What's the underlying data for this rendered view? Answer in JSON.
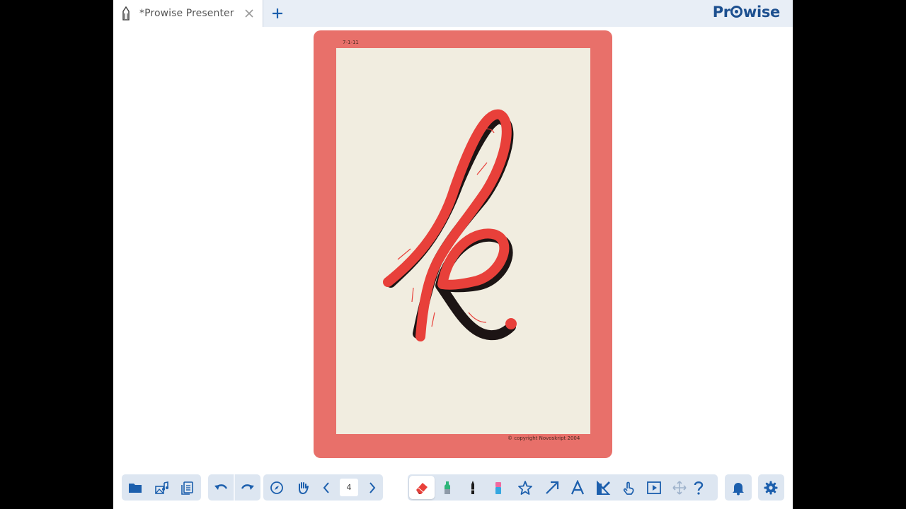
{
  "window": {
    "tab_title": "*Prowise Presenter",
    "brand": {
      "before": "Pr",
      "after": "wise"
    }
  },
  "card": {
    "code": "7-1-11",
    "copyright": "© copyright Novoskript 2004",
    "letter": "k"
  },
  "toolbar": {
    "page_number": "4",
    "file_tools": [
      "folder-icon",
      "media-library-icon",
      "pages-icon"
    ],
    "history_tools": [
      "undo-icon",
      "redo-icon"
    ],
    "navigation_tools": [
      "compass-icon",
      "hand-icon",
      "chevron-left-icon",
      "chevron-right-icon"
    ],
    "drawing_tools": [
      "eraser-icon",
      "highlighter-icon",
      "pen-icon",
      "marker-icon",
      "star-icon",
      "arrow-icon",
      "text-icon",
      "ruler-icon",
      "touch-icon",
      "screen-icon",
      "move-icon",
      "help-icon"
    ],
    "system_tools": [
      "bell-icon",
      "gear-icon"
    ]
  },
  "colors": {
    "accent": "#1c5fad",
    "toolbar_bg": "#dde6f1",
    "tab_bar_bg": "#e8eef6",
    "card_border": "#e8706a",
    "card_paper": "#f1ede0",
    "stroke_red": "#e8403a"
  }
}
